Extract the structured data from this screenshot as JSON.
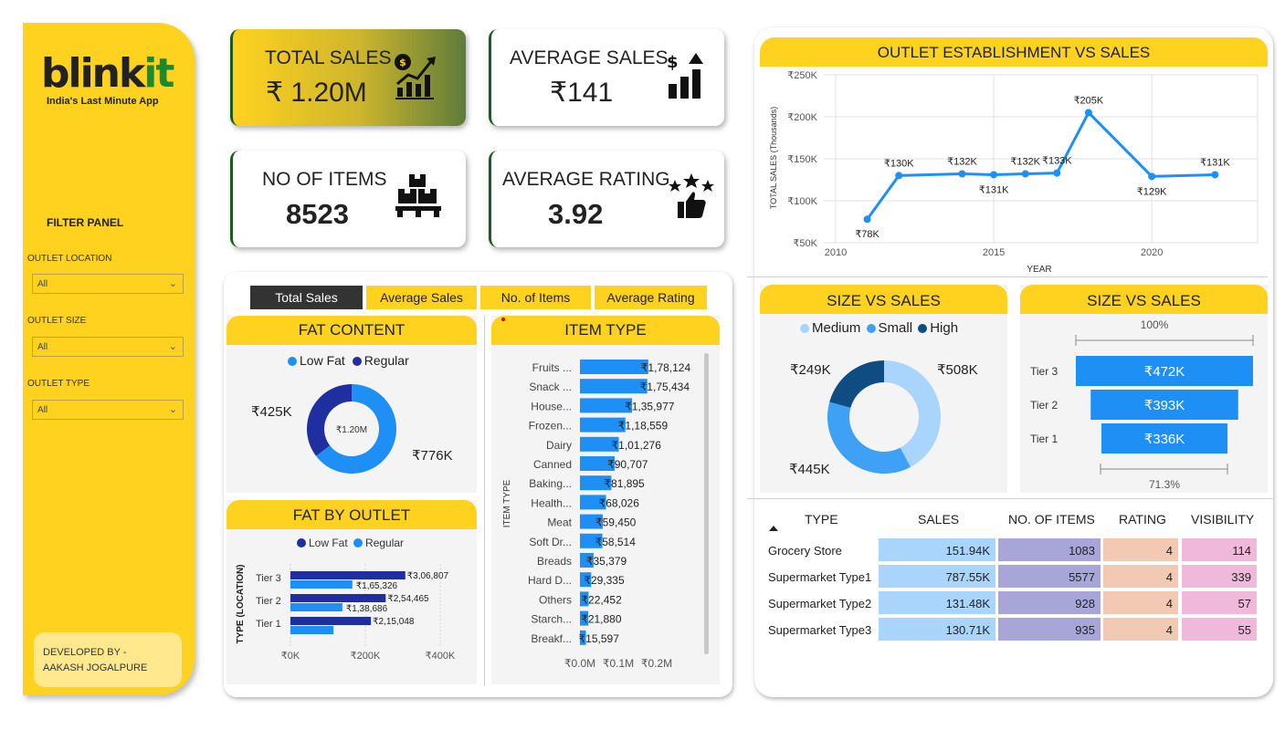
{
  "app": {
    "logo_black": "blink",
    "logo_green": "it",
    "tagline": "India's Last Minute App"
  },
  "filters": {
    "title": "FILTER PANEL",
    "items": [
      {
        "label": "OUTLET LOCATION",
        "value": "All"
      },
      {
        "label": "OUTLET SIZE",
        "value": "All"
      },
      {
        "label": "OUTLET TYPE",
        "value": "All"
      }
    ]
  },
  "developer": {
    "line1": "DEVELOPED BY -",
    "line2": "AAKASH JOGALPURE"
  },
  "kpis": [
    {
      "title": "TOTAL SALES",
      "value": "₹ 1.20M",
      "icon": "money-growth-icon"
    },
    {
      "title": "AVERAGE SALES",
      "value": "₹141",
      "icon": "dollar-bars-icon"
    },
    {
      "title": "NO OF ITEMS",
      "value": "8523",
      "icon": "boxes-pallet-icon"
    },
    {
      "title": "AVERAGE RATING",
      "value": "3.92",
      "icon": "stars-thumb-icon"
    }
  ],
  "tabs": [
    "Total Sales",
    "Average Sales",
    "No. of Items",
    "Average Rating"
  ],
  "fat_content": {
    "title": "FAT CONTENT",
    "legend": [
      "Low Fat",
      "Regular"
    ],
    "center": "₹1.20M",
    "labels": [
      "₹425K",
      "₹776K"
    ],
    "colors": {
      "low_fat": "#1E8FF5",
      "regular": "#1F2FA0"
    }
  },
  "fat_by_outlet": {
    "title": "FAT BY OUTLET",
    "legend": [
      "Low Fat",
      "Regular"
    ],
    "axis_label": "TYPE (LOCATION)",
    "ticks": [
      "₹0K",
      "₹200K",
      "₹400K"
    ]
  },
  "item_type": {
    "title": "ITEM TYPE",
    "axis_label": "ITEM TYPE",
    "ticks": [
      "₹0.0M",
      "₹0.1M",
      "₹0.2M"
    ]
  },
  "establishment": {
    "title": "OUTLET ESTABLISHMENT VS SALES",
    "ylabel": "TOTAL SALES (Thousands)",
    "xlabel": "YEAR"
  },
  "size_donut": {
    "title": "SIZE VS SALES",
    "legend": [
      "Medium",
      "Small",
      "High"
    ],
    "labels": [
      "₹249K",
      "₹508K",
      "₹445K"
    ]
  },
  "size_funnel": {
    "title": "SIZE VS SALES",
    "top_label": "100%",
    "bottom_label": "71.3%"
  },
  "outlet_table": {
    "headers": [
      "TYPE",
      "SALES",
      "NO. OF ITEMS",
      "RATING",
      "VISIBILITY"
    ],
    "rows": [
      [
        "Grocery Store",
        "151.94K",
        "1083",
        "4",
        "114"
      ],
      [
        "Supermarket Type1",
        "787.55K",
        "5577",
        "4",
        "339"
      ],
      [
        "Supermarket Type2",
        "131.48K",
        "928",
        "4",
        "57"
      ],
      [
        "Supermarket Type3",
        "130.71K",
        "935",
        "4",
        "55"
      ]
    ]
  },
  "chart_data": [
    {
      "type": "pie",
      "title": "FAT CONTENT",
      "categories": [
        "Low Fat",
        "Regular"
      ],
      "values": [
        776,
        425
      ],
      "unit": "₹K"
    },
    {
      "type": "bar",
      "title": "FAT BY OUTLET",
      "orientation": "horizontal",
      "categories": [
        "Tier 3",
        "Tier 2",
        "Tier 1"
      ],
      "series": [
        {
          "name": "Low Fat",
          "values": [
            306807,
            254465,
            215048
          ],
          "labels": [
            "₹3,06,807",
            "₹2,54,465",
            "₹2,15,048"
          ]
        },
        {
          "name": "Regular",
          "values": [
            165326,
            138686,
            115000
          ],
          "labels": [
            "₹1,65,326",
            "₹1,38,686",
            ""
          ]
        }
      ],
      "xlim": [
        0,
        400000
      ],
      "ylabel": "TYPE (LOCATION)"
    },
    {
      "type": "bar",
      "title": "ITEM TYPE",
      "orientation": "horizontal",
      "categories": [
        "Fruits ...",
        "Snack ...",
        "House...",
        "Frozen...",
        "Dairy",
        "Canned",
        "Baking...",
        "Health...",
        "Meat",
        "Soft Dr...",
        "Breads",
        "Hard D...",
        "Others",
        "Starch...",
        "Breakf..."
      ],
      "values": [
        178124,
        175434,
        135977,
        118559,
        101276,
        90707,
        81895,
        68026,
        59450,
        58514,
        35379,
        29335,
        22452,
        21880,
        15597
      ],
      "labels": [
        "₹1,78,124",
        "₹1,75,434",
        "₹1,35,977",
        "₹1,18,559",
        "₹1,01,276",
        "₹90,707",
        "₹81,895",
        "₹68,026",
        "₹59,450",
        "₹58,514",
        "₹35,379",
        "₹29,335",
        "₹22,452",
        "₹21,880",
        "₹15,597"
      ],
      "xlim": [
        0,
        200000
      ],
      "ylabel": "ITEM TYPE"
    },
    {
      "type": "line",
      "title": "OUTLET ESTABLISHMENT VS SALES",
      "x": [
        2011,
        2012,
        2014,
        2015,
        2016,
        2017,
        2018,
        2020,
        2022
      ],
      "y": [
        78,
        130,
        132,
        131,
        132,
        133,
        205,
        129,
        131
      ],
      "labels": [
        "₹78K",
        "₹130K",
        "₹132K",
        "₹131K",
        "₹132K",
        "₹133K",
        "₹205K",
        "₹129K",
        "₹131K"
      ],
      "xlabel": "YEAR",
      "ylabel": "TOTAL SALES (Thousands)",
      "xticks": [
        "2010",
        "2015",
        "2020"
      ],
      "yticks": [
        "₹50K",
        "₹100K",
        "₹150K",
        "₹200K",
        "₹250K"
      ],
      "xlim": [
        2010,
        2023
      ],
      "ylim": [
        50,
        250
      ],
      "color": "#1E8FF5"
    },
    {
      "type": "pie",
      "title": "SIZE VS SALES",
      "categories": [
        "Medium",
        "Small",
        "High"
      ],
      "values": [
        508,
        445,
        249
      ],
      "unit": "₹K",
      "colors": [
        "#A9D4FB",
        "#3FA1F5",
        "#0F4C82"
      ]
    },
    {
      "type": "bar",
      "title": "SIZE VS SALES",
      "orientation": "funnel",
      "categories": [
        "Tier 3",
        "Tier 2",
        "Tier 1"
      ],
      "values": [
        472,
        393,
        336
      ],
      "labels": [
        "₹472K",
        "₹393K",
        "₹336K"
      ],
      "unit": "₹K"
    }
  ]
}
